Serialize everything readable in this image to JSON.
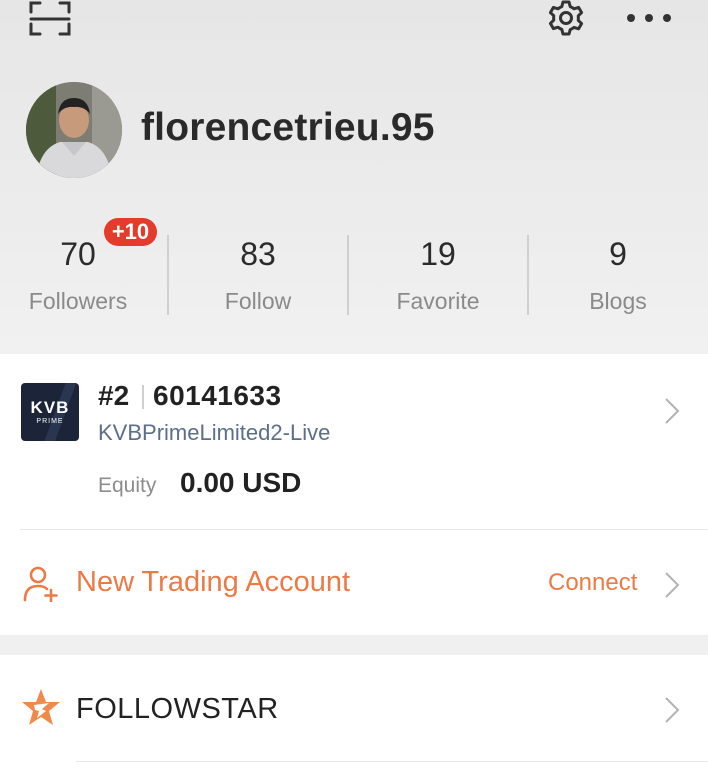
{
  "header": {
    "username": "florencetrieu.95",
    "icons": [
      "scan-icon",
      "gear-icon",
      "more-icon"
    ]
  },
  "stats": [
    {
      "value": "70",
      "label": "Followers",
      "badge": "+10"
    },
    {
      "value": "83",
      "label": "Follow"
    },
    {
      "value": "19",
      "label": "Favorite"
    },
    {
      "value": "9",
      "label": "Blogs"
    }
  ],
  "account": {
    "logo_text": "KVB",
    "logo_subtext": "PRIME",
    "rank": "#2",
    "number": "60141633",
    "server": "KVBPrimeLimited2-Live",
    "equity_label": "Equity",
    "equity_value": "0.00 USD"
  },
  "new_account": {
    "label": "New Trading Account",
    "action": "Connect"
  },
  "followstar": {
    "label": "FOLLOWSTAR"
  },
  "colors": {
    "accent": "#ec7a45",
    "badge": "#e53b2c",
    "link": "#5b6e8a"
  }
}
